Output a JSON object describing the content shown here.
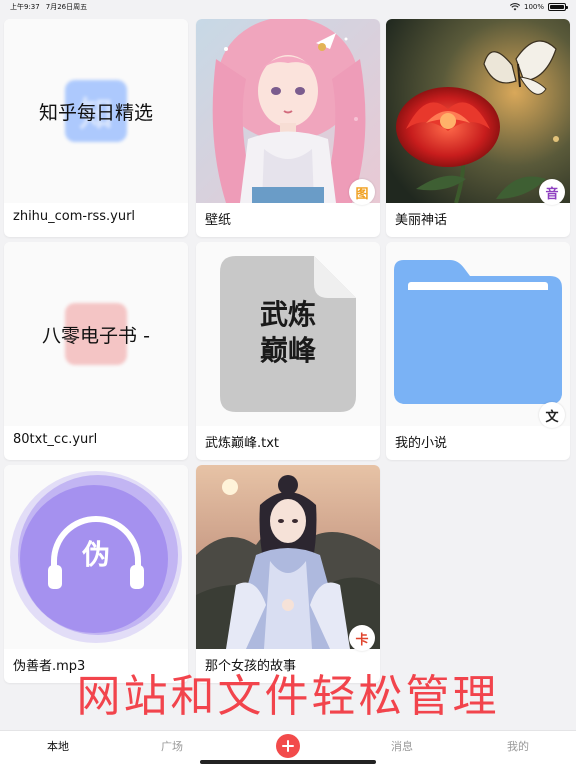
{
  "status_bar": {
    "time": "上午9:37",
    "date": "7月26日周五",
    "battery": "100%",
    "battery_level": 1.0
  },
  "items": [
    {
      "name": "zhihu_com-rss.yurl",
      "thumb_title": "知乎每日精选",
      "glow_char": "知",
      "type": "website",
      "glow_color": "#7aa9ff"
    },
    {
      "name": "壁纸",
      "type": "image-collection",
      "badge": "图",
      "badge_color": "#f0a020"
    },
    {
      "name": "美丽神话",
      "type": "audio-image",
      "badge": "音",
      "badge_color": "#8e3fc0"
    },
    {
      "name": "80txt_cc.yurl",
      "thumb_title": "八零电子书 -",
      "type": "website",
      "glow_color": "#f09a9a"
    },
    {
      "name": "武炼巅峰.txt",
      "thumb_text": "武炼巅峰",
      "type": "text-document"
    },
    {
      "name": "我的小说",
      "type": "folder",
      "badge": "文",
      "badge_color": "#222222",
      "folder_color": "#7ab2f5"
    },
    {
      "name": "伪善者.mp3",
      "thumb_char": "伪",
      "type": "audio",
      "accent_color": "#9b86ee"
    },
    {
      "name": "那个女孩的故事",
      "type": "card-collection",
      "badge": "卡",
      "badge_color": "#e0452e"
    }
  ],
  "caption": "网站和文件轻松管理",
  "tabs": [
    {
      "label": "本地",
      "active": true
    },
    {
      "label": "广场",
      "active": false
    },
    {
      "label": "消息",
      "active": false
    },
    {
      "label": "我的",
      "active": false
    }
  ],
  "add_button_icon": "plus-icon"
}
